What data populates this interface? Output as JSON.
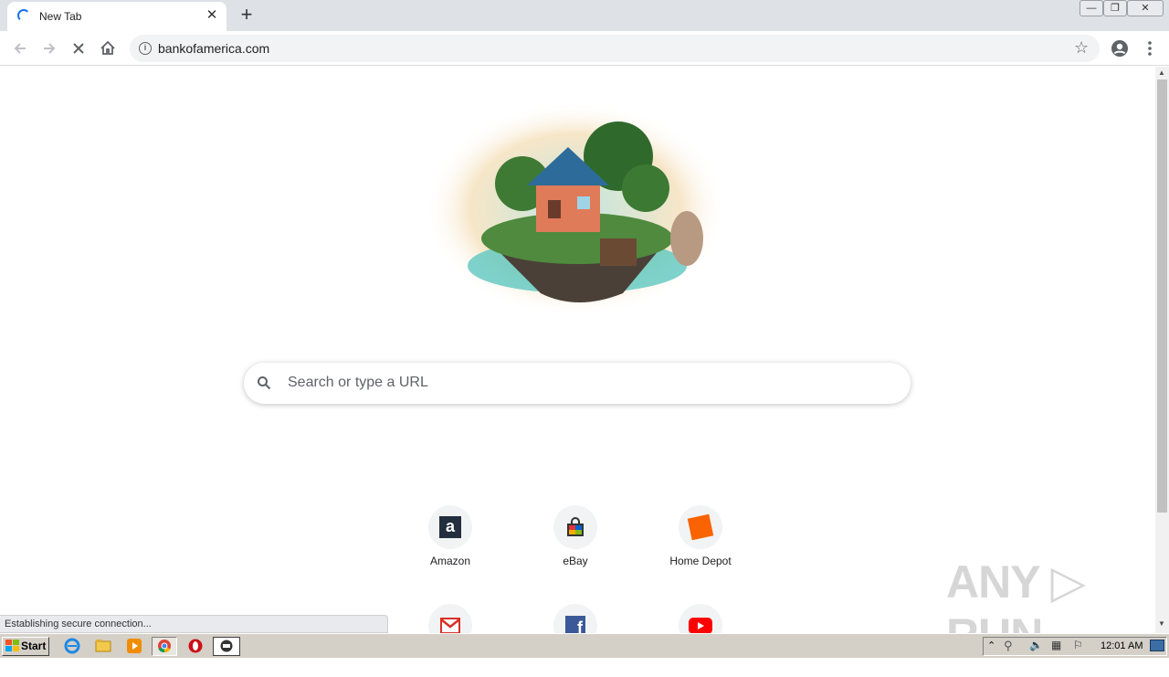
{
  "tab": {
    "title": "New Tab",
    "close_glyph": "✕",
    "new_tab_glyph": "+"
  },
  "window_controls": {
    "minimize": "—",
    "restore": "❐",
    "close": "✕"
  },
  "toolbar": {
    "url": "bankofamerica.com"
  },
  "search": {
    "placeholder": "Search or type a URL"
  },
  "shortcuts": [
    {
      "label": "Amazon",
      "icon": "amazon-icon"
    },
    {
      "label": "eBay",
      "icon": "ebay-icon"
    },
    {
      "label": "Home Depot",
      "icon": "home-depot-icon"
    },
    {
      "label": "",
      "icon": "gmail-icon"
    },
    {
      "label": "",
      "icon": "facebook-icon"
    },
    {
      "label": "",
      "icon": "youtube-icon"
    }
  ],
  "status": {
    "text": "Establishing secure connection..."
  },
  "taskbar": {
    "start_label": "Start",
    "clock": "12:01 AM"
  },
  "watermark": "ANY RUN",
  "colors": {
    "accent": "#1a73e8",
    "home_depot": "#f96302",
    "youtube": "#ff0000",
    "facebook": "#3b5998",
    "gmail": "#d93025"
  }
}
